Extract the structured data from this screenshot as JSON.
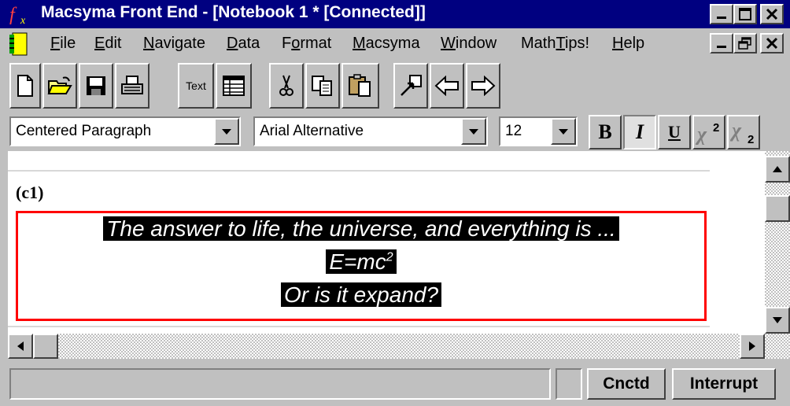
{
  "window": {
    "title": "Macsyma Front End - [Notebook 1 * [Connected]]",
    "app_icon": "macsyma-fx-icon",
    "titlebar_color": "#000080"
  },
  "menu": {
    "items": [
      "File",
      "Edit",
      "Navigate",
      "Data",
      "Format",
      "Macsyma",
      "Window",
      "MathTips!",
      "Help"
    ]
  },
  "toolbar": {
    "icons": [
      "new-document-icon",
      "open-folder-icon",
      "save-disk-icon",
      "print-icon",
      "text-icon",
      "table-icon",
      "cut-icon",
      "copy-icon",
      "paste-icon",
      "jump-icon",
      "back-arrow-icon",
      "forward-arrow-icon"
    ],
    "text_button_label": "Text"
  },
  "format": {
    "paragraph_style": "Centered Paragraph",
    "font_name": "Arial Alternative",
    "font_size": "12",
    "bold_label": "B",
    "italic_label": "I",
    "underline_label": "U",
    "italic_active": true
  },
  "document": {
    "cell_label": "(c1)",
    "lines": [
      "The answer to life, the universe, and everything is ...",
      "E=mc",
      "Or is it expand?"
    ],
    "superscript": "2",
    "highlight_border_color": "#ff0000"
  },
  "status": {
    "message": "",
    "connection": "Cnctd",
    "interrupt": "Interrupt"
  }
}
